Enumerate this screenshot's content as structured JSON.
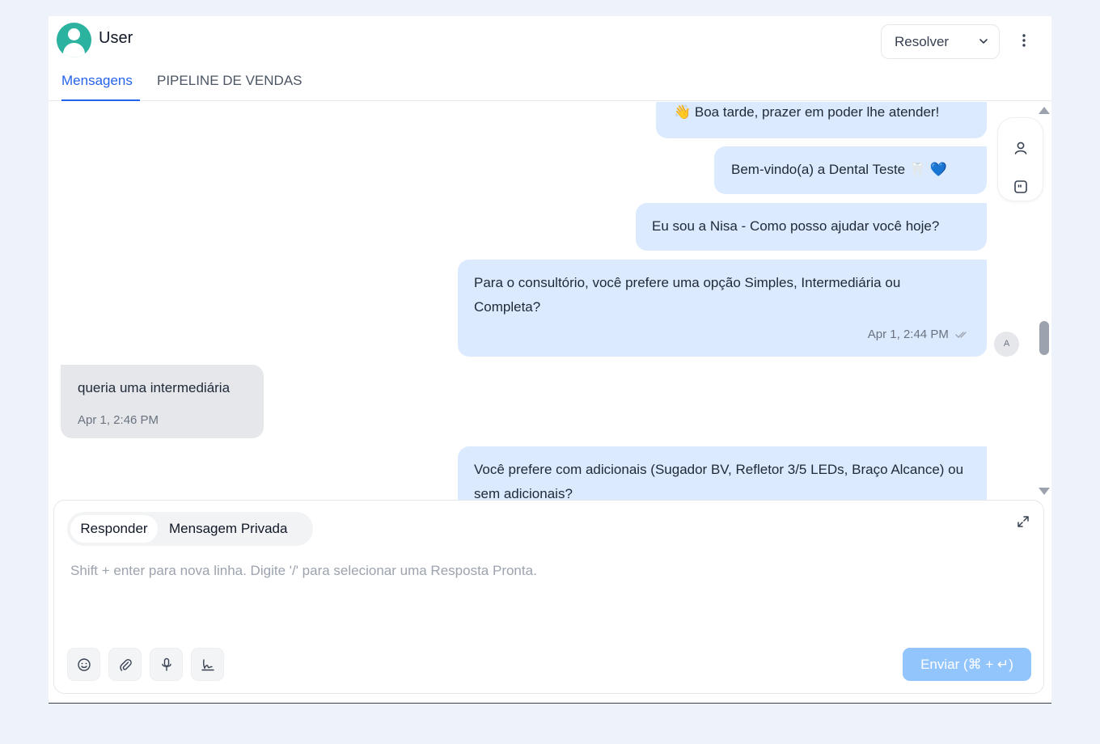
{
  "header": {
    "user_name": "User",
    "resolve_label": "Resolver",
    "tabs": [
      {
        "label": "Mensagens",
        "active": true
      },
      {
        "label": "PIPELINE DE VENDAS",
        "active": false
      }
    ]
  },
  "messages": [
    {
      "direction": "outgoing",
      "text": "👋 Boa tarde, prazer em poder lhe atender!"
    },
    {
      "direction": "outgoing",
      "text": "Bem-vindo(a) a Dental Teste 🦷 💙"
    },
    {
      "direction": "outgoing",
      "text": "Eu sou a Nisa - Como posso ajudar você hoje?"
    },
    {
      "direction": "outgoing",
      "text": "Para o consultório, você prefere uma opção Simples, Intermediária ou Completa?",
      "time": "Apr 1, 2:44 PM",
      "status": "read"
    },
    {
      "direction": "incoming",
      "text": "queria uma intermediária",
      "time": "Apr 1, 2:46 PM"
    },
    {
      "direction": "outgoing",
      "text": "Você prefere com adicionais (Sugador BV, Refletor 3/5 LEDs, Braço Alcance) ou sem adicionais?"
    }
  ],
  "sender_badge": "A",
  "side_actions": {
    "icons": [
      "user-icon",
      "quote-icon"
    ]
  },
  "composer": {
    "mode_reply": "Responder",
    "mode_private": "Mensagem Privada",
    "placeholder": "Shift + enter para nova linha. Digite '/' para selecionar uma Resposta Pronta.",
    "value": "",
    "tools": [
      "emoji-icon",
      "paperclip-icon",
      "microphone-icon",
      "signature-icon"
    ],
    "send_label": "Enviar (⌘ + ↵)"
  },
  "colors": {
    "accent": "#2563eb",
    "outgoing_bubble": "#dbeafe",
    "incoming_bubble": "#e5e7eb",
    "avatar": "#2bb3a0",
    "send_button": "#93c5fd"
  }
}
